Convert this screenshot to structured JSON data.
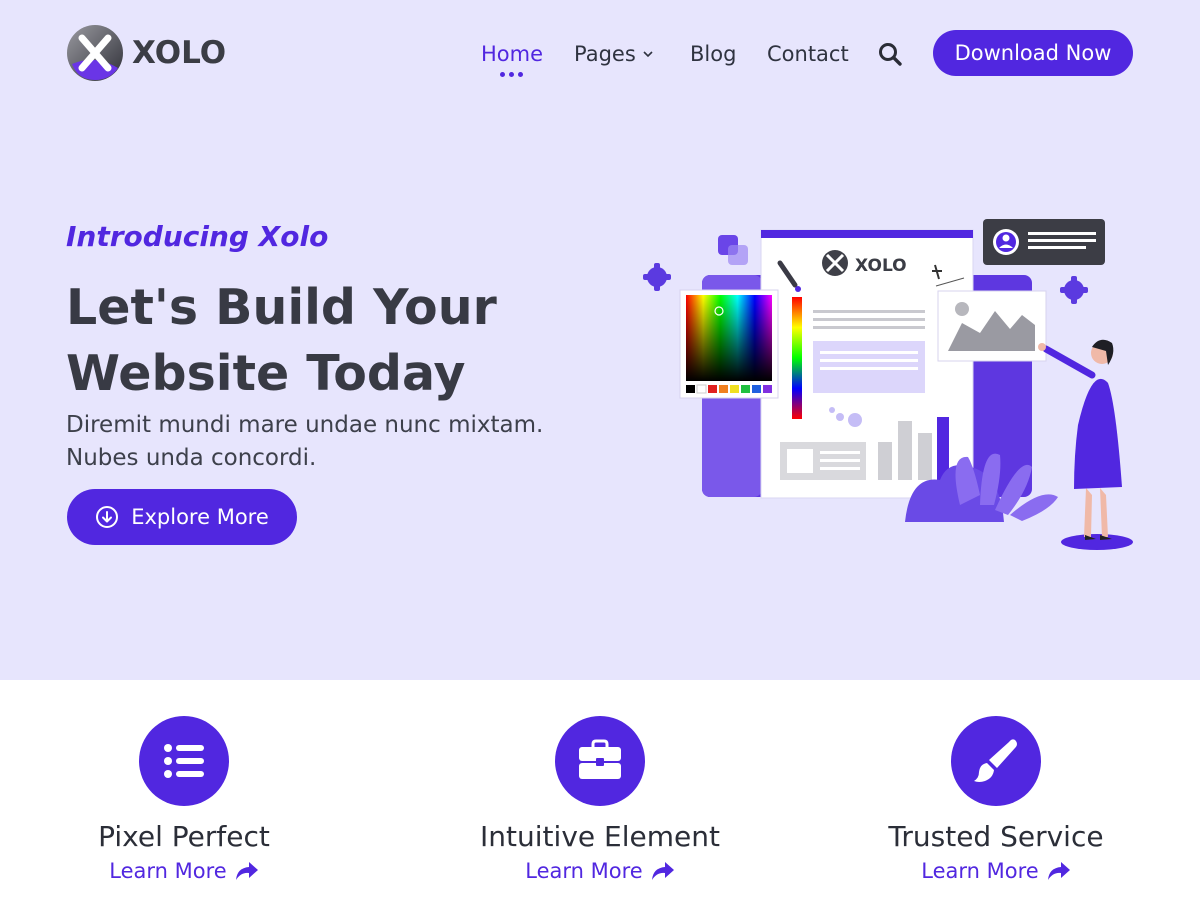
{
  "brand": {
    "name": "XOLO",
    "accent": "#5127e0",
    "hero_bg": "#e7e5fd"
  },
  "nav": {
    "items": [
      {
        "label": "Home",
        "active": true
      },
      {
        "label": "Pages",
        "has_dropdown": true
      },
      {
        "label": "Blog"
      },
      {
        "label": "Contact"
      }
    ],
    "search_icon": "search-icon",
    "cta_label": "Download Now"
  },
  "hero": {
    "eyebrow": "Introducing Xolo",
    "headline": "Let's Build Your Website Today",
    "subtext": "Diremit mundi mare undae nunc mixtam. Nubes unda concordi.",
    "button_label": "Explore More",
    "button_icon": "arrow-circle-down-icon",
    "illustration_logo": "XOLO"
  },
  "features": [
    {
      "title": "Pixel Perfect",
      "link": "Learn More",
      "icon": "list-icon"
    },
    {
      "title": "Intuitive Element",
      "link": "Learn More",
      "icon": "briefcase-icon"
    },
    {
      "title": "Trusted Service",
      "link": "Learn More",
      "icon": "paintbrush-icon"
    }
  ]
}
